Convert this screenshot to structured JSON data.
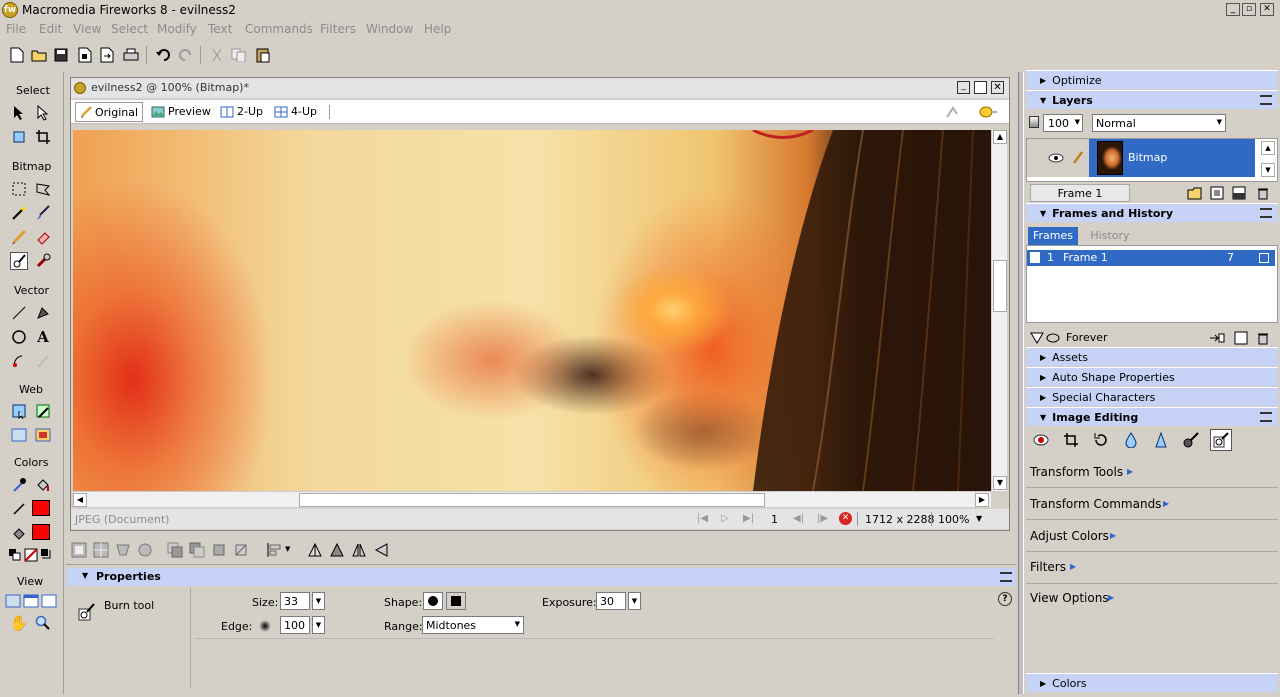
{
  "window": {
    "title": "Macromedia Fireworks 8 - evilness2",
    "controls": {
      "minimize": "_",
      "restore": "▫",
      "close": "✕"
    }
  },
  "menu": [
    "File",
    "Edit",
    "View",
    "Select",
    "Modify",
    "Text",
    "Commands",
    "Filters",
    "Window",
    "Help"
  ],
  "toolbox": {
    "sections": [
      "Select",
      "Bitmap",
      "Vector",
      "Web",
      "Colors",
      "View"
    ],
    "stroke_color": "#ff0000",
    "fill_color": "#ff0000"
  },
  "document": {
    "title": "evilness2 @ 100% (Bitmap)*",
    "tabs": [
      "Original",
      "Preview",
      "2-Up",
      "4-Up"
    ],
    "status_left": "JPEG (Document)",
    "frame_number": "1",
    "dimensions": "1712 x 2288",
    "zoom": "100%"
  },
  "properties": {
    "title": "Properties",
    "tool_name": "Burn tool",
    "size_label": "Size:",
    "size_value": "33",
    "edge_label": "Edge:",
    "edge_value": "100",
    "shape_label": "Shape:",
    "range_label": "Range:",
    "range_value": "Midtones",
    "exposure_label": "Exposure:",
    "exposure_value": "30",
    "help": "?"
  },
  "right_panels": {
    "optimize": "Optimize",
    "layers": {
      "title": "Layers",
      "opacity": "100",
      "blend": "Normal",
      "layer_name": "Bitmap",
      "frame_label": "Frame 1"
    },
    "frames_history": {
      "title": "Frames and History",
      "tabs": [
        "Frames",
        "History"
      ],
      "frame_index": "1",
      "frame_name": "Frame 1",
      "frame_delay": "7",
      "loop": "Forever"
    },
    "assets": "Assets",
    "auto_shape": "Auto Shape Properties",
    "special_chars": "Special Characters",
    "image_editing": {
      "title": "Image Editing",
      "menus": [
        "Transform Tools",
        "Transform Commands",
        "Adjust Colors",
        "Filters",
        "View Options"
      ]
    },
    "colors": "Colors"
  },
  "accent": "#316ac5",
  "panel_title_bg": "#c6d3f7"
}
